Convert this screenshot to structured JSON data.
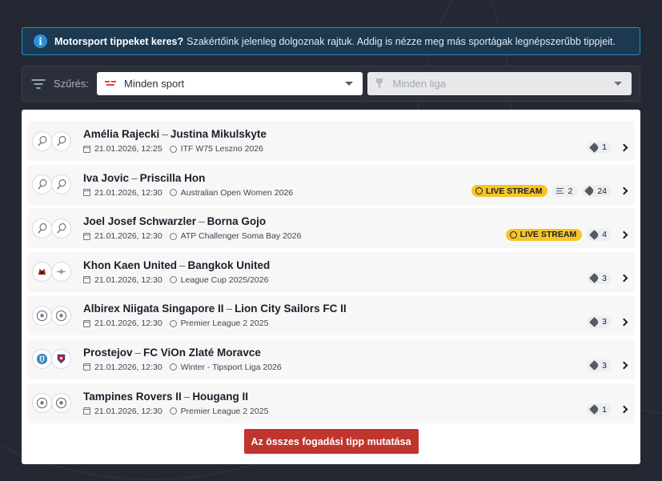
{
  "banner": {
    "bold": "Motorsport tippeket keres?",
    "text": "Szakértőink jelenleg dolgoznak rajtuk. Addig is nézze meg más sportágak legnépszerűbb tippjeit."
  },
  "filter": {
    "label": "Szűrés:",
    "sport_value": "Minden sport",
    "liga_value": "Minden liga"
  },
  "matches": [
    {
      "home": "Amélia Rajecki",
      "away": "Justina Mikulskyte",
      "date": "21.01.2026, 12:25",
      "league": "ITF W75 Leszno 2026",
      "sport": "tennis",
      "live": false,
      "streams": null,
      "tips": "1"
    },
    {
      "home": "Iva Jovic",
      "away": "Priscilla Hon",
      "date": "21.01.2026, 12:30",
      "league": "Australian Open Women 2026",
      "sport": "tennis",
      "live": true,
      "streams": "2",
      "tips": "24"
    },
    {
      "home": "Joel Josef Schwarzler",
      "away": "Borna Gojo",
      "date": "21.01.2026, 12:30",
      "league": "ATP Challenger Soma Bay 2026",
      "sport": "tennis",
      "live": true,
      "streams": null,
      "tips": "4"
    },
    {
      "home": "Khon Kaen United",
      "away": "Bangkok United",
      "date": "21.01.2026, 12:30",
      "league": "League Cup 2025/2026",
      "sport": "club",
      "live": false,
      "streams": null,
      "tips": "3"
    },
    {
      "home": "Albirex Niigata Singapore II",
      "away": "Lion City Sailors FC II",
      "date": "21.01.2026, 12:30",
      "league": "Premier League 2 2025",
      "sport": "soccer",
      "live": false,
      "streams": null,
      "tips": "3"
    },
    {
      "home": "Prostejov",
      "away": "FC ViOn Zlaté Moravce",
      "date": "21.01.2026, 12:30",
      "league": "Winter - Tipsport Liga 2026",
      "sport": "crest",
      "live": false,
      "streams": null,
      "tips": "3"
    },
    {
      "home": "Tampines Rovers II",
      "away": "Hougang II",
      "date": "21.01.2026, 12:30",
      "league": "Premier League 2 2025",
      "sport": "soccer",
      "live": false,
      "streams": null,
      "tips": "1"
    }
  ],
  "live_label": "LIVE STREAM",
  "dash": "–",
  "cta_label": "Az összes fogadási tipp mutatása",
  "colors": {
    "accent_red": "#c0352e",
    "live_yellow": "#f7c427",
    "info_blue": "#1f8fcf"
  }
}
